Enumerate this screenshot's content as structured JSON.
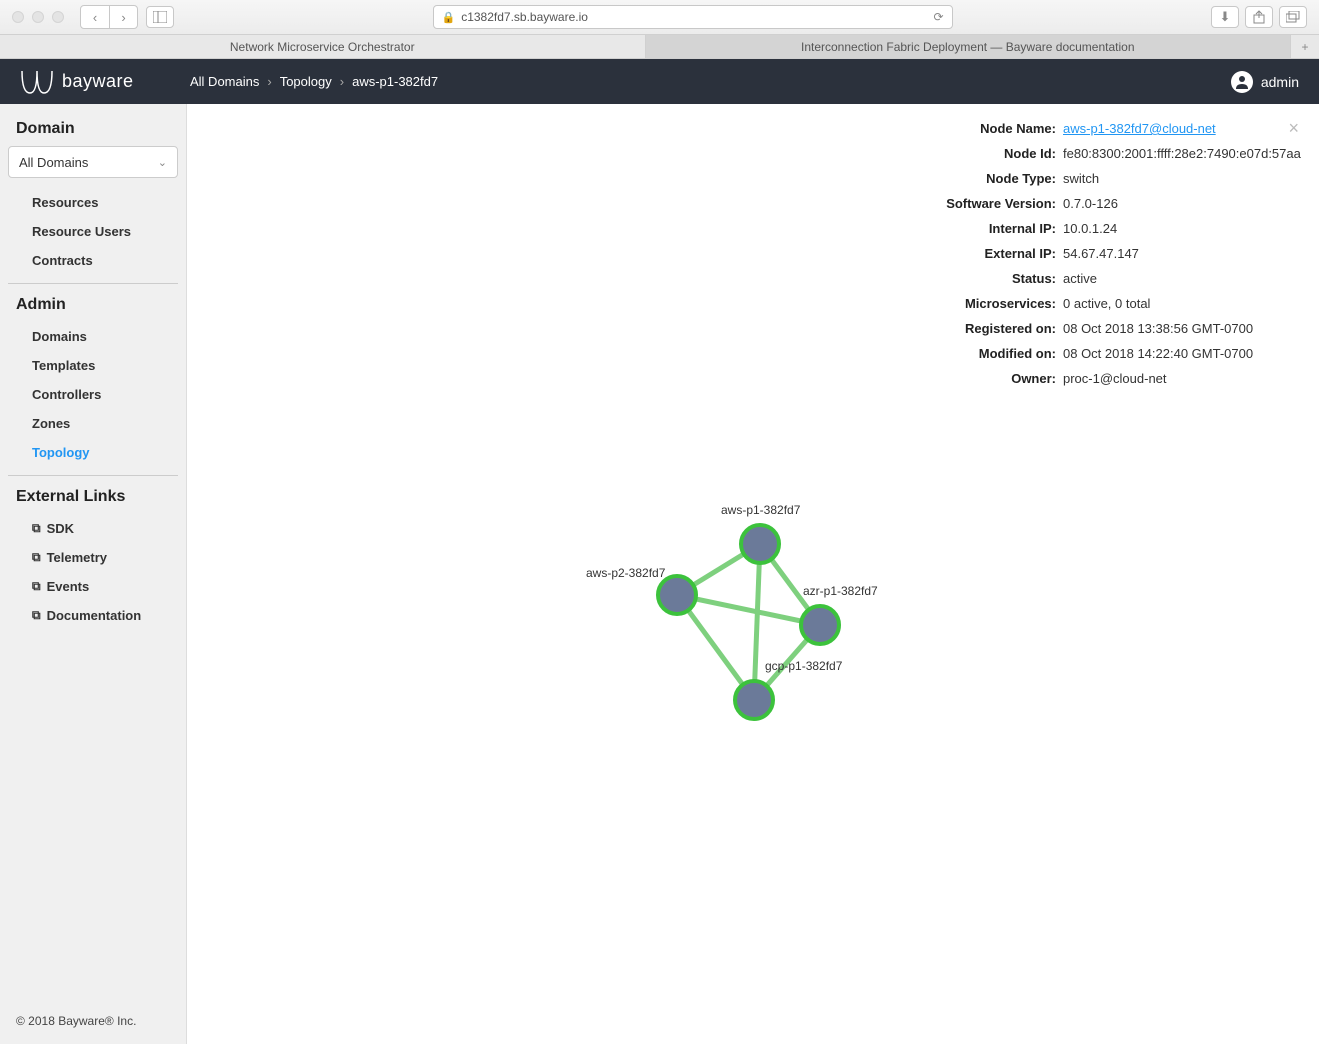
{
  "browser": {
    "url": "c1382fd7.sb.bayware.io",
    "tabs": [
      {
        "label": "Network Microservice Orchestrator",
        "active": true
      },
      {
        "label": "Interconnection Fabric Deployment — Bayware documentation",
        "active": false
      }
    ]
  },
  "header": {
    "brand": "bayware",
    "breadcrumb": [
      "All Domains",
      "Topology",
      "aws-p1-382fd7"
    ],
    "user": "admin"
  },
  "sidebar": {
    "domain_section": "Domain",
    "domain_select": "All Domains",
    "domain_items": [
      "Resources",
      "Resource Users",
      "Contracts"
    ],
    "admin_section": "Admin",
    "admin_items": [
      "Domains",
      "Templates",
      "Controllers",
      "Zones",
      "Topology"
    ],
    "admin_active": "Topology",
    "external_section": "External Links",
    "external_links": [
      "SDK",
      "Telemetry",
      "Events",
      "Documentation"
    ],
    "footer": "© 2018 Bayware® Inc."
  },
  "topology": {
    "nodes": [
      {
        "id": "aws-p1-382fd7",
        "label_pos": "top"
      },
      {
        "id": "azr-p1-382fd7",
        "label_pos": "right"
      },
      {
        "id": "aws-p2-382fd7",
        "label_pos": "left"
      },
      {
        "id": "gcp-p1-382fd7",
        "label_pos": "right"
      }
    ]
  },
  "details": {
    "fields": [
      {
        "label": "Node Name:",
        "value": "aws-p1-382fd7@cloud-net",
        "link": true
      },
      {
        "label": "Node Id:",
        "value": "fe80:8300:2001:ffff:28e2:7490:e07d:57aa"
      },
      {
        "label": "Node Type:",
        "value": "switch"
      },
      {
        "label": "Software Version:",
        "value": "0.7.0-126"
      },
      {
        "label": "Internal IP:",
        "value": "10.0.1.24"
      },
      {
        "label": "External IP:",
        "value": "54.67.47.147"
      },
      {
        "label": "Status:",
        "value": "active"
      },
      {
        "label": "Microservices:",
        "value": "0 active, 0 total"
      },
      {
        "label": "Registered on:",
        "value": "08 Oct 2018 13:38:56 GMT-0700"
      },
      {
        "label": "Modified on:",
        "value": "08 Oct 2018 14:22:40 GMT-0700"
      },
      {
        "label": "Owner:",
        "value": "proc-1@cloud-net"
      }
    ]
  }
}
